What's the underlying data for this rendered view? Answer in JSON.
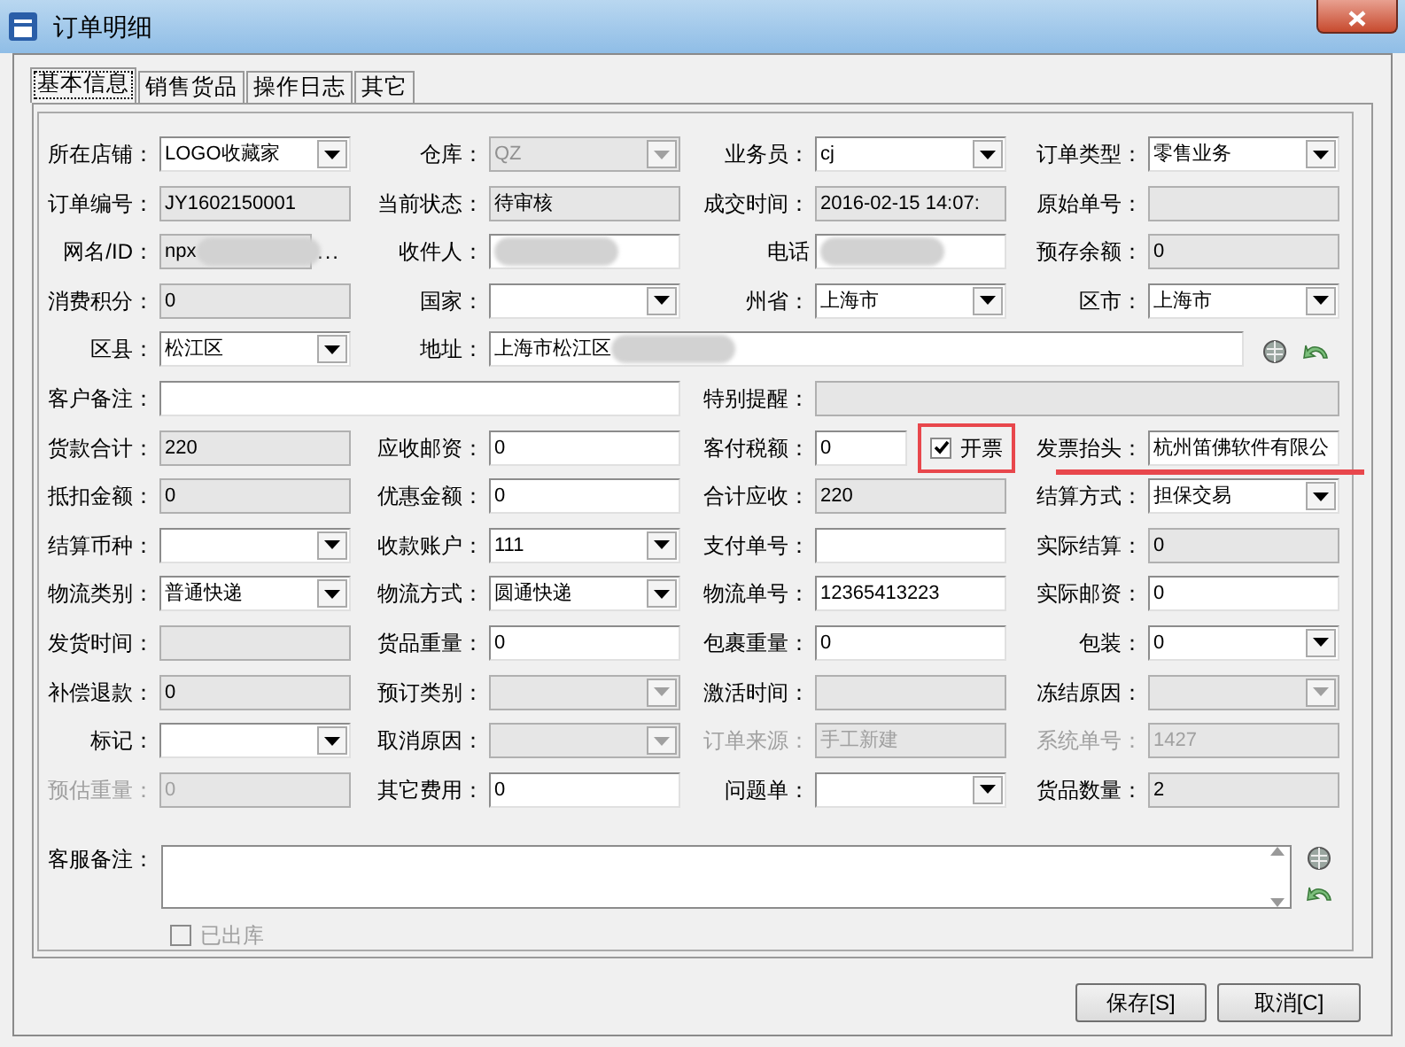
{
  "window": {
    "title": "订单明细"
  },
  "tabs": [
    {
      "label": "基本信息",
      "selected": true
    },
    {
      "label": "销售货品",
      "selected": false
    },
    {
      "label": "操作日志",
      "selected": false
    },
    {
      "label": "其它",
      "selected": false
    }
  ],
  "rows": [
    [
      {
        "label": "所在店铺：",
        "kind": "select",
        "value": "LOGO收藏家",
        "readonly": false,
        "disabled": false
      },
      {
        "label": "仓库：",
        "kind": "select",
        "value": "QZ",
        "readonly": true,
        "disabled": false
      },
      {
        "label": "业务员：",
        "kind": "select",
        "value": "cj",
        "readonly": false,
        "disabled": false
      },
      {
        "label": "订单类型：",
        "kind": "select",
        "value": "零售业务",
        "readonly": false,
        "disabled": false
      }
    ],
    [
      {
        "label": "订单编号：",
        "kind": "text",
        "value": "JY1602150001",
        "readonly": true,
        "disabled": false
      },
      {
        "label": "当前状态：",
        "kind": "text",
        "value": "待审核",
        "readonly": true,
        "disabled": false
      },
      {
        "label": "成交时间：",
        "kind": "text",
        "value": "2016-02-15 14:07:",
        "readonly": true,
        "disabled": false
      },
      {
        "label": "原始单号：",
        "kind": "text",
        "readonly": true,
        "disabled": false
      }
    ],
    [
      {
        "label": "网名/ID：",
        "kind": "lookup",
        "value": "npx",
        "lookup": "...",
        "readonly": true,
        "disabled": false,
        "redacted": true
      },
      {
        "label": "收件人：",
        "kind": "text",
        "readonly": false,
        "disabled": false,
        "redacted": true
      },
      {
        "label": "电话",
        "kind": "text",
        "readonly": false,
        "disabled": false,
        "redacted": true
      },
      {
        "label": "预存余额：",
        "kind": "text",
        "value": "0",
        "readonly": true,
        "disabled": false
      }
    ],
    [
      {
        "label": "消费积分：",
        "kind": "text",
        "value": "0",
        "readonly": true,
        "disabled": false
      },
      {
        "label": "国家：",
        "kind": "select",
        "readonly": false,
        "disabled": false
      },
      {
        "label": "州省：",
        "kind": "select",
        "value": "上海市",
        "readonly": false,
        "disabled": false
      },
      {
        "label": "区市：",
        "kind": "select",
        "value": "上海市",
        "readonly": false,
        "disabled": false
      }
    ],
    [
      {
        "label": "区县：",
        "kind": "select",
        "value": "松江区",
        "readonly": false,
        "disabled": false
      },
      {
        "label": "地址：",
        "kind": "address",
        "value": "上海市松江区",
        "readonly": false,
        "disabled": false,
        "redacted": true
      }
    ],
    [
      {
        "label": "客户备注：",
        "kind": "wide",
        "readonly": false,
        "disabled": false
      },
      {
        "label": "特别提醒：",
        "kind": "wide",
        "readonly": true,
        "disabled": false
      }
    ],
    [
      {
        "label": "货款合计：",
        "kind": "text",
        "value": "220",
        "readonly": true,
        "disabled": false
      },
      {
        "label": "应收邮资：",
        "kind": "text",
        "value": "0",
        "readonly": false,
        "disabled": false
      },
      {
        "label": "客付税额：",
        "kind": "text",
        "value": "0",
        "readonly": false,
        "disabled": false,
        "checkbox": {
          "label": "开票",
          "checked": true,
          "highlighted": true
        }
      },
      {
        "label": "发票抬头：",
        "kind": "text",
        "value": "杭州笛佛软件有限公",
        "readonly": false,
        "disabled": false,
        "underlined": true
      }
    ],
    [
      {
        "label": "抵扣金额：",
        "kind": "text",
        "value": "0",
        "readonly": true,
        "disabled": false
      },
      {
        "label": "优惠金额：",
        "kind": "text",
        "value": "0",
        "readonly": false,
        "disabled": false
      },
      {
        "label": "合计应收：",
        "kind": "text",
        "value": "220",
        "readonly": true,
        "disabled": false
      },
      {
        "label": "结算方式：",
        "kind": "select",
        "value": "担保交易",
        "readonly": false,
        "disabled": false
      }
    ],
    [
      {
        "label": "结算币种：",
        "kind": "select",
        "readonly": false,
        "disabled": false
      },
      {
        "label": "收款账户：",
        "kind": "select",
        "value": "111",
        "readonly": false,
        "disabled": false
      },
      {
        "label": "支付单号：",
        "kind": "text",
        "readonly": false,
        "disabled": false
      },
      {
        "label": "实际结算：",
        "kind": "text",
        "value": "0",
        "readonly": true,
        "disabled": false
      }
    ],
    [
      {
        "label": "物流类别：",
        "kind": "select",
        "value": "普通快递",
        "readonly": false,
        "disabled": false
      },
      {
        "label": "物流方式：",
        "kind": "select",
        "value": "圆通快递",
        "readonly": false,
        "disabled": false
      },
      {
        "label": "物流单号：",
        "kind": "text",
        "value": "12365413223",
        "readonly": false,
        "disabled": false
      },
      {
        "label": "实际邮资：",
        "kind": "text",
        "value": "0",
        "readonly": false,
        "disabled": false
      }
    ],
    [
      {
        "label": "发货时间：",
        "kind": "text",
        "readonly": true,
        "disabled": false
      },
      {
        "label": "货品重量：",
        "kind": "text",
        "value": "0",
        "readonly": false,
        "disabled": false
      },
      {
        "label": "包裹重量：",
        "kind": "text",
        "value": "0",
        "readonly": false,
        "disabled": false
      },
      {
        "label": "包装：",
        "kind": "select",
        "value": "0",
        "readonly": false,
        "disabled": false
      }
    ],
    [
      {
        "label": "补偿退款：",
        "kind": "text",
        "value": "0",
        "readonly": true,
        "disabled": false
      },
      {
        "label": "预订类别：",
        "kind": "select",
        "readonly": true,
        "disabled": false
      },
      {
        "label": "激活时间：",
        "kind": "text",
        "readonly": true,
        "disabled": false
      },
      {
        "label": "冻结原因：",
        "kind": "select",
        "readonly": true,
        "disabled": false
      }
    ],
    [
      {
        "label": "标记：",
        "kind": "select",
        "readonly": false,
        "disabled": false
      },
      {
        "label": "取消原因：",
        "kind": "select",
        "readonly": true,
        "disabled": false
      },
      {
        "label": "订单来源：",
        "kind": "text",
        "value": "手工新建",
        "readonly": true,
        "disabled": true
      },
      {
        "label": "系统单号：",
        "kind": "text",
        "value": "1427",
        "readonly": true,
        "disabled": true
      }
    ],
    [
      {
        "label": "预估重量：",
        "kind": "text",
        "value": "0",
        "readonly": true,
        "disabled": true
      },
      {
        "label": "其它费用：",
        "kind": "text",
        "value": "0",
        "readonly": false,
        "disabled": false
      },
      {
        "label": "问题单：",
        "kind": "select",
        "readonly": false,
        "disabled": false
      },
      {
        "label": "货品数量：",
        "kind": "text",
        "value": "2",
        "readonly": true,
        "disabled": false
      }
    ]
  ],
  "service_note": {
    "label": "客服备注："
  },
  "shipped": {
    "label": "已出库",
    "checked": false,
    "disabled": true
  },
  "buttons": [
    "保存[S]",
    "取消[C]"
  ]
}
